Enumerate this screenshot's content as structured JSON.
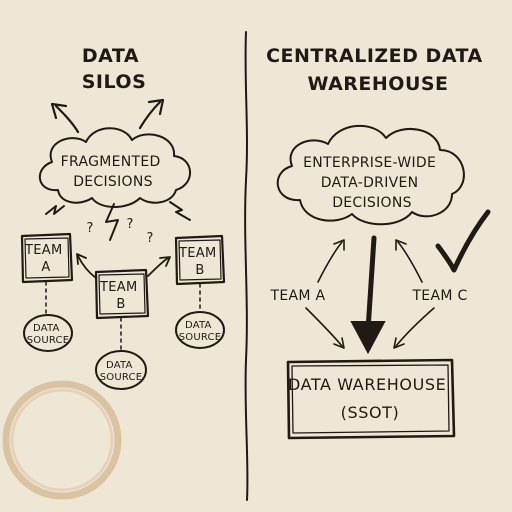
{
  "left": {
    "title_lines": [
      "DATA",
      "SILOS"
    ],
    "cloud_lines": [
      "FRAGMENTED",
      "DECISIONS"
    ],
    "teams": [
      {
        "lines": [
          "TEAM",
          "A"
        ],
        "source_lines": [
          "DATA",
          "SOURCE"
        ]
      },
      {
        "lines": [
          "TEAM",
          "B"
        ],
        "source_lines": [
          "DATA",
          "SOURCE"
        ]
      },
      {
        "lines": [
          "TEAM",
          "B"
        ],
        "source_lines": [
          "DATA",
          "SOURCE"
        ]
      }
    ],
    "question_marks": [
      "?",
      "?",
      "?"
    ]
  },
  "right": {
    "title_lines": [
      "CENTRALIZED DATA",
      "WAREHOUSE"
    ],
    "cloud_lines": [
      "ENTERPRISE-WIDE",
      "DATA-DRIVEN",
      "DECISIONS"
    ],
    "team_left": "TEAM A",
    "team_right": "TEAM C",
    "warehouse_lines": [
      "DATA WAREHOUSE",
      "(SSOT)"
    ]
  },
  "colors": {
    "paper": "#efe7d6",
    "ink": "#1f1a14",
    "stain": "#c7a57a"
  }
}
